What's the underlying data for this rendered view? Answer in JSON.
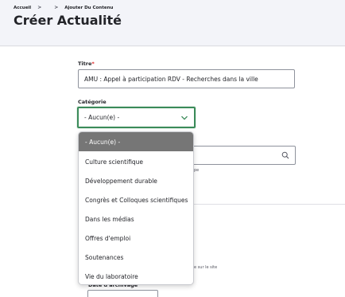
{
  "breadcrumb": {
    "items": [
      "Accueil",
      "Ajouter Du Contenu"
    ],
    "separator": ">"
  },
  "page": {
    "title": "Créer Actualité"
  },
  "form": {
    "title_field": {
      "label": "Titre",
      "required_mark": "*",
      "value": "AMU : Appel à participation RDV - Recherches dans la ville"
    },
    "category": {
      "label": "Catégorie",
      "selected": "- Aucun(e) -",
      "options": [
        "- Aucun(e) -",
        "Culture scientifique",
        "Développement durable",
        "Congrès et Colloques scientifiques",
        "Dans les médias",
        "Offres d'emploi",
        "Soutenances",
        "Vie du laboratoire"
      ],
      "highlighted_index": 0
    },
    "helper_text_1": "pe",
    "helper_text_2": "e sur le site",
    "archive": {
      "label": "Date d'archivage"
    }
  },
  "colors": {
    "focus_border": "#3b8b5a",
    "option_highlight": "#767676",
    "required": "#dc2323"
  },
  "icons": {
    "select_arrow": "chevron-down-icon",
    "search": "search-icon"
  }
}
